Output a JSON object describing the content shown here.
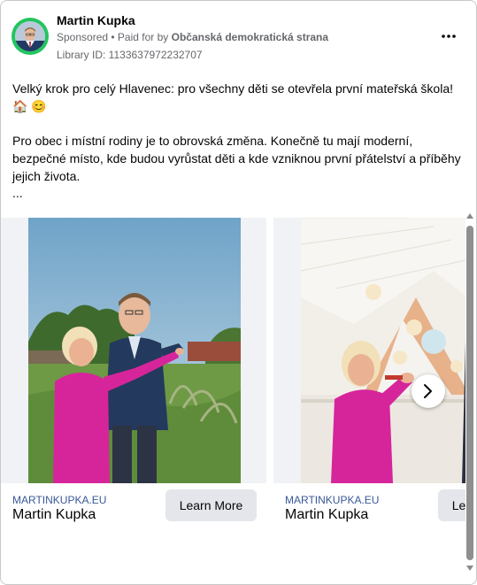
{
  "post": {
    "page_name": "Martin Kupka",
    "sponsored_label": "Sponsored",
    "paid_for_prefix": " • Paid for by ",
    "paid_for_by": "Občanská demokratická strana",
    "library_id": "Library ID: 1133637972232707",
    "paragraph1": "Velký krok pro celý Hlavenec: pro všechny děti se otevřela první mateřská škola! 🏠 😊",
    "paragraph2": "Pro obec i místní rodiny je to obrovská změna. Konečně tu mají moderní, bezpečné místo, kde budou vyrůstat děti a kde vzniknou první přátelství a příběhy jejich života.",
    "ellipsis": "..."
  },
  "cards": [
    {
      "domain": "MARTINKUPKA.EU",
      "title": "Martin Kupka",
      "button": "Learn More"
    },
    {
      "domain": "MARTINKUPKA.EU",
      "title": "Martin Kupka",
      "button": "Learn More"
    }
  ],
  "icons": {
    "more": "more-horizontal-icon",
    "next": "chevron-right-icon"
  },
  "colors": {
    "avatar_ring": "#22c55e",
    "link_domain": "#385898",
    "button_bg": "#e4e6eb",
    "dress_pink": "#d6259a"
  }
}
